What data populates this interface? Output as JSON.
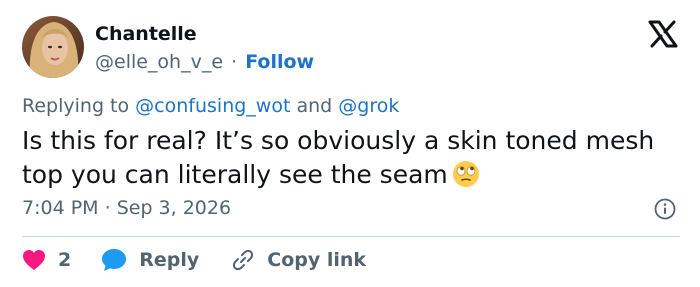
{
  "author": {
    "display_name": "Chantelle",
    "handle": "@elle_oh_v_e",
    "separator": "·",
    "follow_label": "Follow"
  },
  "reply_context": {
    "prefix": "Replying to",
    "mention_1": "@confusing_wot",
    "conjunction": "and",
    "mention_2": "@grok"
  },
  "tweet": {
    "text": "Is this for real? It’s so obviously a skin toned mesh top you can literally see the seam",
    "emoji": "face-with-rolling-eyes",
    "time": "7:04 PM",
    "separator": "·",
    "date": "Sep 3, 2026"
  },
  "actions": {
    "like_count": "2",
    "reply_label": "Reply",
    "copy_label": "Copy link"
  },
  "colors": {
    "link": "#1d73c9",
    "secondary_text": "#536471",
    "like": "#f91880",
    "reply_icon": "#1d9bf0",
    "divider": "#cfd9de"
  }
}
